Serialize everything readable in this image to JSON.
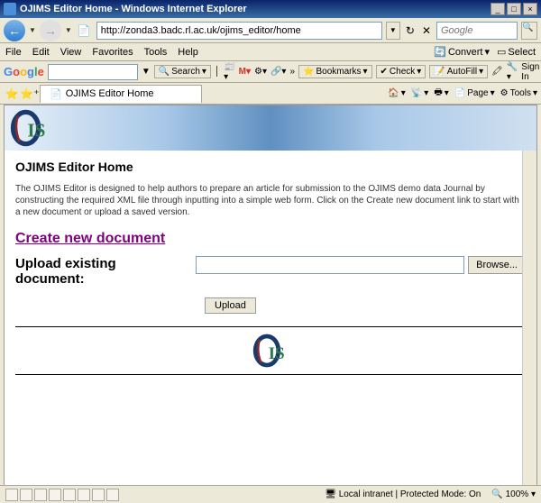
{
  "window": {
    "title": "OJIMS Editor Home - Windows Internet Explorer",
    "min": "_",
    "max": "□",
    "close": "×"
  },
  "nav": {
    "url": "http://zonda3.badc.rl.ac.uk/ojims_editor/home",
    "search_placeholder": "Google",
    "search_icon": "🔍"
  },
  "menu": {
    "file": "File",
    "edit": "Edit",
    "view": "View",
    "favorites": "Favorites",
    "tools": "Tools",
    "help": "Help",
    "convert": "Convert",
    "select": "Select"
  },
  "gbar": {
    "search_label": "Search",
    "bookmarks": "Bookmarks",
    "check": "Check",
    "autofill": "AutoFill",
    "signin": "Sign In"
  },
  "tab": {
    "title": "OJIMS Editor Home",
    "home": "Home",
    "print": "Print",
    "page": "Page",
    "tools": "Tools"
  },
  "page": {
    "heading": "OJIMS Editor Home",
    "description": "The OJIMS Editor is designed to help authors to prepare an article for submission to the OJIMS demo data Journal by constructing the required XML file through inputting into a simple web form. Click on the Create new document link to start with a new document or upload a saved version.",
    "create_link": "Create new document",
    "upload_label": "Upload existing document:",
    "browse": "Browse...",
    "upload_btn": "Upload"
  },
  "status": {
    "zone": "Local intranet | Protected Mode: On",
    "zoom": "100%"
  }
}
